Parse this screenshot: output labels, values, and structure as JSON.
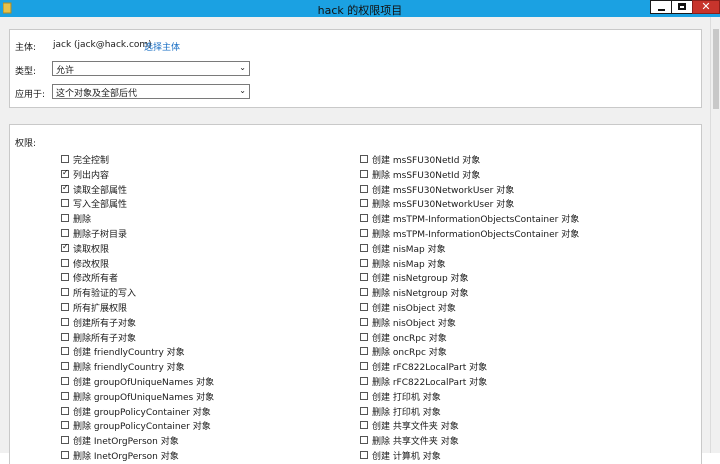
{
  "window": {
    "title": "hack 的权限项目",
    "close_glyph": "✕"
  },
  "principal": {
    "label": "主体:",
    "value": "jack (jack@hack.com)",
    "select_link": "选择主体"
  },
  "type": {
    "label": "类型:",
    "value": "允许"
  },
  "applies_to": {
    "label": "应用于:",
    "value": "这个对象及全部后代"
  },
  "permissions": {
    "label": "权限:",
    "left": [
      {
        "label": "完全控制",
        "checked": false
      },
      {
        "label": "列出内容",
        "checked": true
      },
      {
        "label": "读取全部属性",
        "checked": true
      },
      {
        "label": "写入全部属性",
        "checked": false
      },
      {
        "label": "删除",
        "checked": false
      },
      {
        "label": "删除子树目录",
        "checked": false
      },
      {
        "label": "读取权限",
        "checked": true
      },
      {
        "label": "修改权限",
        "checked": false
      },
      {
        "label": "修改所有者",
        "checked": false
      },
      {
        "label": "所有验证的写入",
        "checked": false
      },
      {
        "label": "所有扩展权限",
        "checked": false
      },
      {
        "label": "创建所有子对象",
        "checked": false
      },
      {
        "label": "删除所有子对象",
        "checked": false
      },
      {
        "label": "创建 friendlyCountry 对象",
        "checked": false
      },
      {
        "label": "删除 friendlyCountry 对象",
        "checked": false
      },
      {
        "label": "创建 groupOfUniqueNames 对象",
        "checked": false
      },
      {
        "label": "删除 groupOfUniqueNames 对象",
        "checked": false
      },
      {
        "label": "创建 groupPolicyContainer 对象",
        "checked": false
      },
      {
        "label": "删除 groupPolicyContainer 对象",
        "checked": false
      },
      {
        "label": "创建 InetOrgPerson 对象",
        "checked": false
      },
      {
        "label": "删除 InetOrgPerson 对象",
        "checked": false
      }
    ],
    "right": [
      {
        "label": "创建 msSFU30NetId 对象",
        "checked": false
      },
      {
        "label": "删除 msSFU30NetId 对象",
        "checked": false
      },
      {
        "label": "创建 msSFU30NetworkUser 对象",
        "checked": false
      },
      {
        "label": "删除 msSFU30NetworkUser 对象",
        "checked": false
      },
      {
        "label": "创建 msTPM-InformationObjectsContainer 对象",
        "checked": false
      },
      {
        "label": "删除 msTPM-InformationObjectsContainer 对象",
        "checked": false
      },
      {
        "label": "创建 nisMap 对象",
        "checked": false
      },
      {
        "label": "删除 nisMap 对象",
        "checked": false
      },
      {
        "label": "创建 nisNetgroup 对象",
        "checked": false
      },
      {
        "label": "删除 nisNetgroup 对象",
        "checked": false
      },
      {
        "label": "创建 nisObject 对象",
        "checked": false
      },
      {
        "label": "删除 nisObject 对象",
        "checked": false
      },
      {
        "label": "创建 oncRpc 对象",
        "checked": false
      },
      {
        "label": "删除 oncRpc 对象",
        "checked": false
      },
      {
        "label": "创建 rFC822LocalPart 对象",
        "checked": false
      },
      {
        "label": "删除 rFC822LocalPart 对象",
        "checked": false
      },
      {
        "label": "创建 打印机 对象",
        "checked": false
      },
      {
        "label": "删除 打印机 对象",
        "checked": false
      },
      {
        "label": "创建 共享文件夹 对象",
        "checked": false
      },
      {
        "label": "删除 共享文件夹 对象",
        "checked": false
      },
      {
        "label": "创建 计算机 对象",
        "checked": false
      }
    ]
  }
}
